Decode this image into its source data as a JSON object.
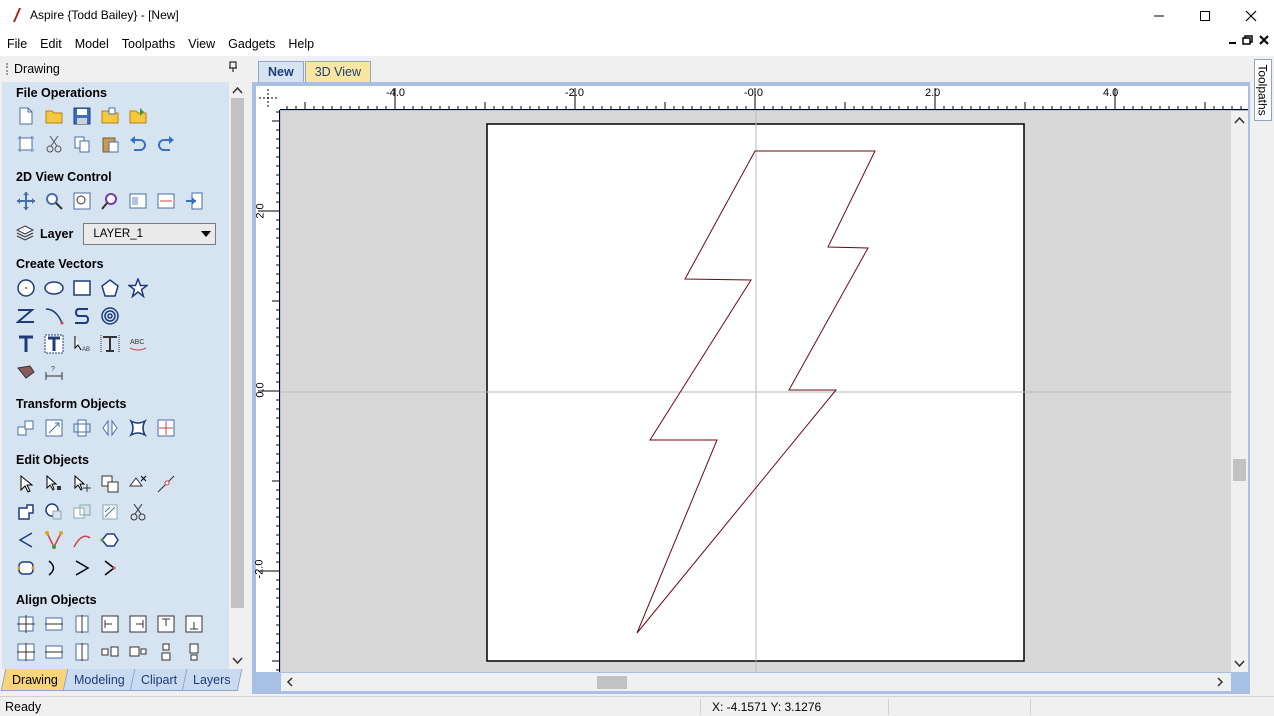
{
  "window": {
    "title": "Aspire {Todd Bailey} - [New]"
  },
  "menu": [
    "File",
    "Edit",
    "Model",
    "Toolpaths",
    "View",
    "Gadgets",
    "Help"
  ],
  "left_panel": {
    "header": "Drawing",
    "sections": {
      "file_operations": "File Operations",
      "view_control": "2D View Control",
      "create_vectors": "Create Vectors",
      "transform_objects": "Transform Objects",
      "edit_objects": "Edit Objects",
      "align_objects": "Align Objects"
    },
    "layer": {
      "label": "Layer",
      "value": "LAYER_1"
    },
    "tabs": [
      "Drawing",
      "Modeling",
      "Clipart",
      "Layers"
    ],
    "active_tab": "Drawing"
  },
  "doc_tabs": [
    "New",
    "3D View"
  ],
  "active_doc_tab": "New",
  "side_tab": "Toolpaths",
  "ruler": {
    "h_labels": [
      "-4.0",
      "-2.0",
      "-0.0",
      "2.0",
      "4.0"
    ],
    "v_labels": [
      "2.0",
      "0.0",
      "-2.0"
    ]
  },
  "status": {
    "text": "Ready",
    "coords": "X: -4.1571 Y:  3.1276"
  },
  "colors": {
    "panel_bg": "#d6e3f1",
    "active_tab": "#f9d57a",
    "frame": "#a7c0e3",
    "vector": "#6b0a14"
  }
}
